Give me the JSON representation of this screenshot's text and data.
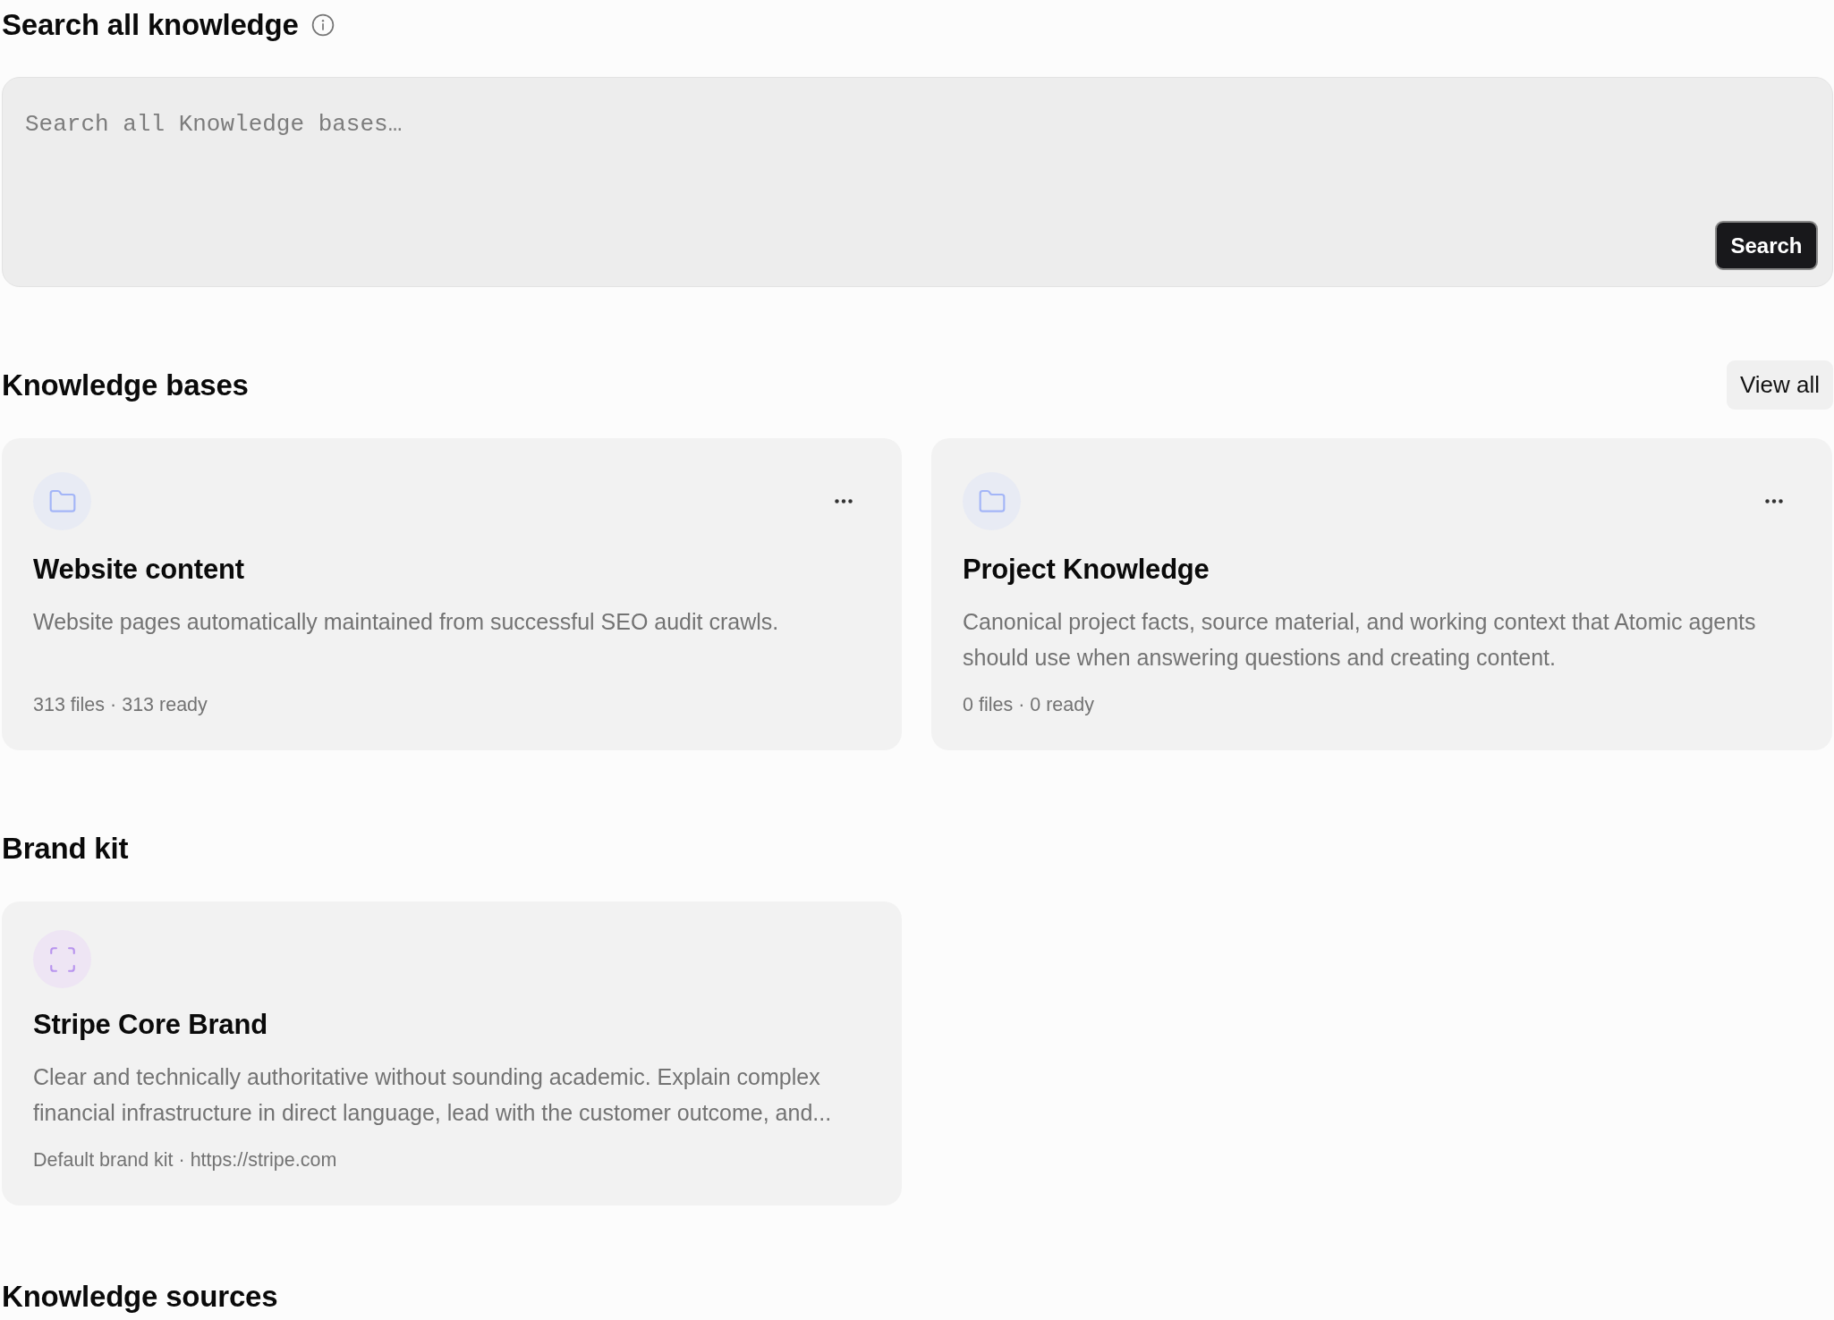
{
  "header": {
    "title": "Search all knowledge"
  },
  "search": {
    "placeholder": "Search all Knowledge bases…",
    "button": "Search"
  },
  "knowledge_bases": {
    "title": "Knowledge bases",
    "view_all": "View all",
    "items": [
      {
        "name": "Website content",
        "description": "Website pages automatically maintained from successful SEO audit crawls.",
        "details": "313 files · 313 ready"
      },
      {
        "name": "Project Knowledge",
        "description": "Canonical project facts, source material, and working context that Atomic agents should use when answering questions and creating content.",
        "details": "0 files · 0 ready"
      }
    ]
  },
  "brand_kit": {
    "title": "Brand kit",
    "items": [
      {
        "name": "Stripe Core Brand",
        "description": "Clear and technically authoritative without sounding academic. Explain complex financial infrastructure in direct language, lead with the customer outcome, and...",
        "details": "Default brand kit · https://stripe.com"
      }
    ]
  },
  "knowledge_sources": {
    "title": "Knowledge sources"
  }
}
